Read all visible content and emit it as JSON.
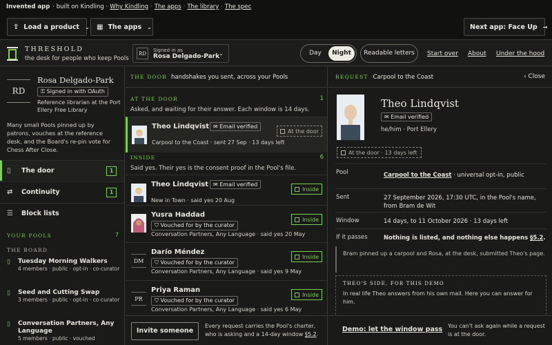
{
  "topstrip": {
    "title": "Invented app",
    "built_on": "· built on Kindling ·",
    "links": [
      "Why Kindling",
      "The apps",
      "The library",
      "The spec"
    ]
  },
  "toolbar": {
    "load_label": "Load a product",
    "apps_label": "The apps",
    "next_label": "Next app: Face Up"
  },
  "header": {
    "brand_title": "THRESHOLD",
    "brand_sub": "the desk for people who keep Pools",
    "signed_in_initials": "RD",
    "signed_in_label": "Signed in as",
    "signed_in_name": "Rosa Delgado-Park",
    "day": "Day",
    "night": "Night",
    "readable": "Readable letters",
    "links": [
      "Start over",
      "About",
      "Under the hood"
    ]
  },
  "sidebar": {
    "initials": "RD",
    "name": "Rosa Delgado-Park",
    "oauth": "Signed in with OAuth",
    "role": "Reference librarian at the Port Ellery Free Library",
    "desc": "Many small Pools pinned up by patrons, vouches at the reference desk, and the Board's re-pin vote for Chess After Close.",
    "nav": [
      {
        "label": "The door",
        "count": "1"
      },
      {
        "label": "Continuity",
        "count": "1"
      },
      {
        "label": "Block lists",
        "count": ""
      }
    ],
    "your_pools_label": "YOUR POOLS",
    "your_pools_count": "7",
    "board_label": "THE BOARD",
    "pools": [
      {
        "name": "Tuesday Morning Walkers",
        "meta": "4 members · public · opt-in · co-curator"
      },
      {
        "name": "Seed and Cutting Swap",
        "meta": "3 members · public · opt-in · co-curator"
      },
      {
        "name": "Conversation Partners, Any Language",
        "meta": "5 members · public · vouched"
      }
    ]
  },
  "center": {
    "header_caps": "THE DOOR",
    "header_desc": "handshakes you sent, across your Pools",
    "at_door_label": "AT THE DOOR",
    "at_door_count": "1",
    "at_door_sub": "Asked, and waiting for their answer. Each window is 14 days.",
    "inside_label": "INSIDE",
    "inside_count": "6",
    "inside_sub": "Said yes. Their yes is the consent proof in the Pool's file.",
    "cards": [
      {
        "name": "Theo Lindqvist",
        "badge": "Email verified",
        "meta": "Carpool to the Coast · sent 27 Sep · 13 days left",
        "status": "At the door"
      },
      {
        "name": "Theo Lindqvist",
        "badge": "Email verified",
        "meta": "New in Town · said yes 20 Aug",
        "status": "Inside"
      },
      {
        "name": "Yusra Haddad",
        "badge": "Vouched for by the curator",
        "meta": "Conversation Partners, Any Language · said yes 20 May",
        "status": "Inside"
      },
      {
        "name": "Darío Méndez",
        "initials": "DM",
        "badge": "Vouched for by the curator",
        "meta": "Conversation Partners, Any Language · said yes 9 May",
        "status": "Inside"
      },
      {
        "name": "Priya Raman",
        "initials": "PR",
        "badge": "Vouched for by the curator",
        "meta": "Conversation Partners, Any Language · said yes 6 May",
        "status": "Inside"
      }
    ],
    "invite_label": "Invite someone",
    "footer_note_a": "Every request carries the Pool's charter, who is asking and a 14-day window ",
    "footer_note_link": "§5.2",
    "footer_note_b": "."
  },
  "right": {
    "header_caps": "REQUEST",
    "header_desc": "Carpool to the Coast",
    "close_label": "Close",
    "name": "Theo Lindqvist",
    "badge": "Email verified",
    "pronouns": "he/him · Port Ellery",
    "door_status": "At the door · 13 days left",
    "rows": [
      {
        "key": "Pool",
        "link": "Carpool to the Coast",
        "rest": " · universal opt-in, public"
      },
      {
        "key": "Sent",
        "value": "27 September 2026, 17:30 UTC, in the Pool's name, from Bram de Wit"
      },
      {
        "key": "Window",
        "value": "14 days, to 11 October 2026 · 13 days left"
      },
      {
        "key": "If it passes",
        "value": "Nothing is listed, and nothing else happens ",
        "link": "§5.2",
        "tail": "."
      }
    ],
    "note": "Bram pinned up a carpool and Rosa, at the desk, submitted Theo's page.",
    "theo_caps": "THEO'S SIDE, FOR THIS DEMO",
    "theo_text": "In real life Theo answers from his own mail. Here you can answer for him.",
    "demo_label": "Demo: let the window pass",
    "footer_note": "You can't ask again while a request is at the door."
  }
}
